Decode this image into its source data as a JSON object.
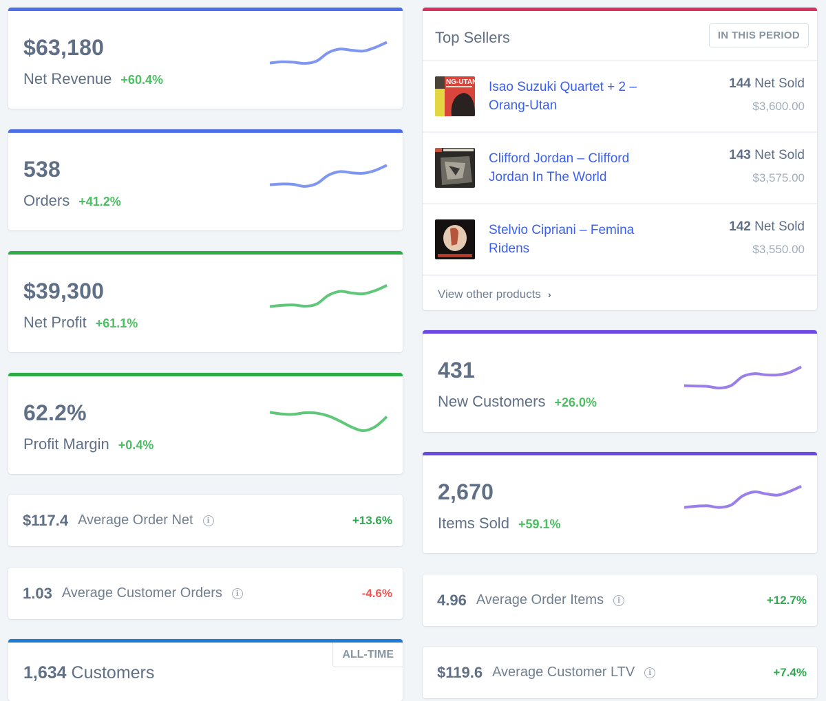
{
  "colors": {
    "blue": "#4c6fe8",
    "green": "#2fad45",
    "crimson": "#d8305f",
    "purple": "#6c48e3",
    "customers_blue": "#1f7ad6",
    "positive": "#4cbf62",
    "negative": "#ef5753",
    "spark_blue": "#7f97f0",
    "spark_green": "#5fc779",
    "spark_purple": "#9a7eea"
  },
  "stats_left": [
    {
      "value": "$63,180",
      "label": "Net Revenue",
      "delta": "+60.4%",
      "accent": "blue",
      "spark_color": "spark_blue",
      "spark": [
        3,
        3.3,
        3.2,
        2.9,
        3.5,
        5.6,
        6.5,
        6.2,
        6.0,
        6.9,
        8.2
      ]
    },
    {
      "value": "538",
      "label": "Orders",
      "delta": "+41.2%",
      "accent": "blue",
      "spark_color": "spark_blue",
      "spark": [
        3,
        3.2,
        3.1,
        2.6,
        3.3,
        5.4,
        6.3,
        6.0,
        5.9,
        6.6,
        7.9
      ]
    },
    {
      "value": "$39,300",
      "label": "Net Profit",
      "delta": "+61.1%",
      "accent": "green",
      "spark_color": "spark_green",
      "spark": [
        3,
        3.3,
        3.4,
        3.1,
        3.6,
        5.8,
        6.8,
        6.4,
        6.2,
        7.0,
        8.3
      ]
    },
    {
      "value": "62.2%",
      "label": "Profit Margin",
      "delta": "+0.4%",
      "accent": "green",
      "spark_color": "spark_green",
      "spark": [
        7.0,
        6.6,
        6.5,
        6.9,
        6.8,
        6.1,
        4.8,
        3.3,
        2.4,
        3.4,
        5.9
      ]
    }
  ],
  "small_left": [
    {
      "value": "$117.4",
      "label": "Average Order Net",
      "delta": "+13.6%",
      "negative": false
    },
    {
      "value": "1.03",
      "label": "Average Customer Orders",
      "delta": "-4.6%",
      "negative": true
    }
  ],
  "customers": {
    "value": "1,634",
    "label": "Customers",
    "badge": "ALL-TIME"
  },
  "top_sellers": {
    "title": "Top Sellers",
    "badge": "IN THIS PERIOD",
    "items": [
      {
        "name": "Isao Suzuki Quartet + 2 – Orang-Utan",
        "sold_count": "144",
        "sold_label": "Net Sold",
        "price": "$3,600.00",
        "thumb": "orang-utan-album-cover"
      },
      {
        "name": "Clifford Jordan – Clifford Jordan In The World",
        "sold_count": "143",
        "sold_label": "Net Sold",
        "price": "$3,575.00",
        "thumb": "clifford-jordan-album-cover"
      },
      {
        "name": "Stelvio Cipriani – Femina Ridens",
        "sold_count": "142",
        "sold_label": "Net Sold",
        "price": "$3,550.00",
        "thumb": "femina-ridens-album-cover"
      }
    ],
    "footer_link": "View other products",
    "footer_icon": "chevron-right-icon"
  },
  "stats_right": [
    {
      "value": "431",
      "label": "New Customers",
      "delta": "+26.0%",
      "accent": "purple",
      "spark_color": "spark_purple",
      "spark": [
        3,
        2.9,
        2.8,
        2.4,
        3.0,
        5.3,
        6.0,
        5.7,
        5.7,
        6.3,
        7.7
      ]
    },
    {
      "value": "2,670",
      "label": "Items Sold",
      "delta": "+59.1%",
      "accent": "purple",
      "spark_color": "spark_purple",
      "spark": [
        3,
        3.3,
        3.4,
        3.0,
        3.6,
        5.9,
        6.9,
        6.4,
        6.1,
        7.0,
        8.3
      ]
    }
  ],
  "small_right": [
    {
      "value": "4.96",
      "label": "Average Order Items",
      "delta": "+12.7%",
      "negative": false
    },
    {
      "value": "$119.6",
      "label": "Average Customer LTV",
      "delta": "+7.4%",
      "negative": false
    }
  ]
}
